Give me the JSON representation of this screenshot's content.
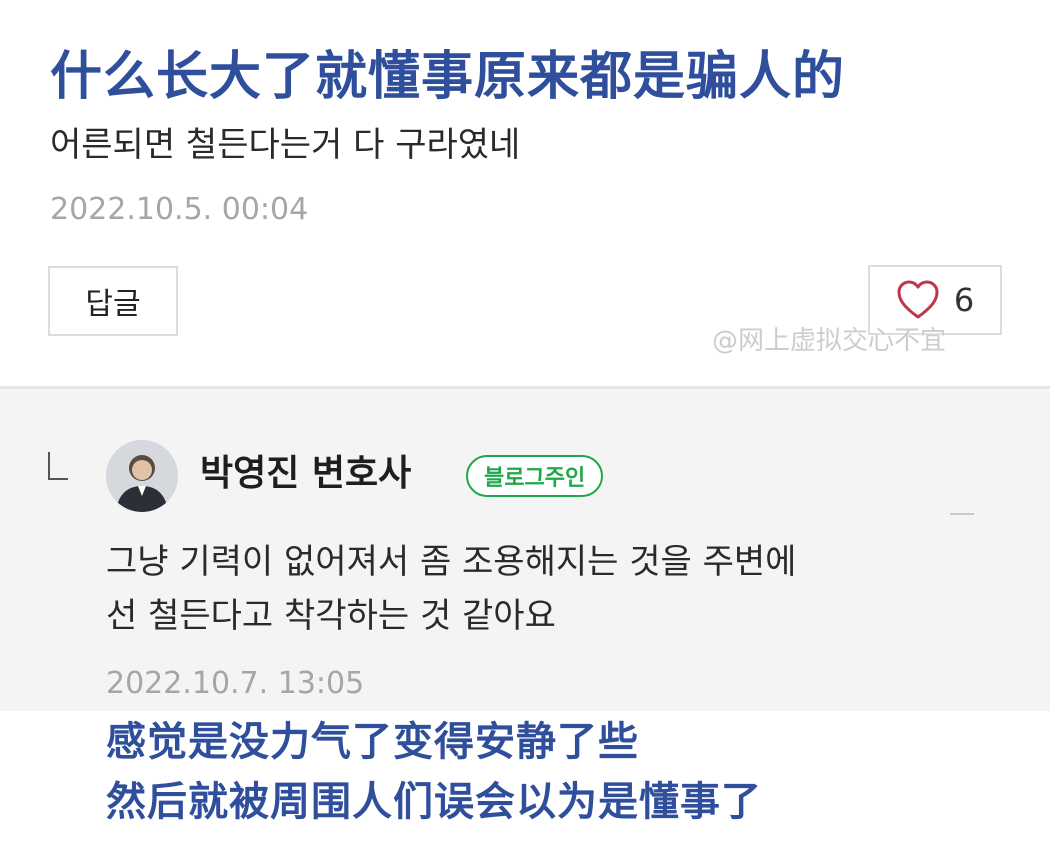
{
  "post": {
    "caption_top": "什么长大了就懂事原来都是骗人的",
    "comment_text": "어른되면 철든다는거 다 구라였네",
    "timestamp": "2022.10.5. 00:04",
    "reply_button_label": "답글",
    "like_count": "6",
    "watermark": "@网上虚拟交心不宜"
  },
  "reply": {
    "author_name": "박영진 변호사",
    "owner_badge": "블로그주인",
    "text_line1": "그냥 기력이 없어져서 좀 조용해지는 것을 주변에",
    "text_line2": "선 철든다고 착각하는 것 같아요",
    "timestamp": "2022.10.7. 13:05"
  },
  "translation": {
    "line1": "感觉是没力气了变得安静了些",
    "line2": "然后就被周围人们误会以为是懂事了"
  },
  "icons": {
    "like": "heart-icon",
    "reply_marker": "reply-corner-icon",
    "avatar": "avatar"
  },
  "colors": {
    "caption": "#2f4f9c",
    "badge": "#1fa84a",
    "heart": "#c0354a",
    "reply_background": "#f4f4f4"
  }
}
